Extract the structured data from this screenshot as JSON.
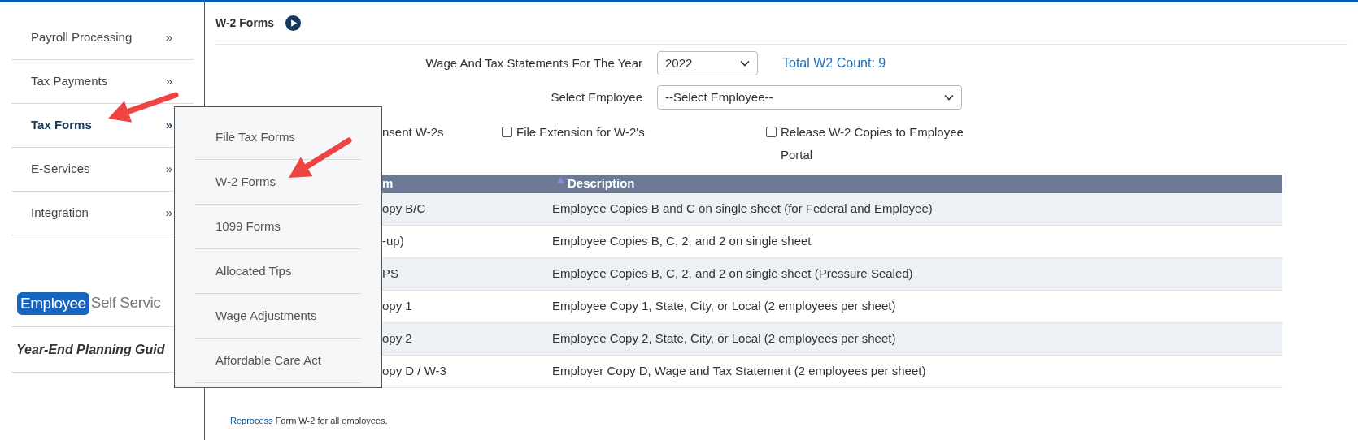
{
  "sidebar": {
    "items": [
      {
        "label": "Payroll Processing",
        "chevron": "»",
        "selected": false
      },
      {
        "label": "Tax Payments",
        "chevron": "»",
        "selected": false
      },
      {
        "label": "Tax Forms",
        "chevron": "»",
        "selected": true
      },
      {
        "label": "E-Services",
        "chevron": "»",
        "selected": false
      },
      {
        "label": "Integration",
        "chevron": "»",
        "selected": false
      }
    ],
    "logo": {
      "badge": "Employee",
      "text": "Self Servic"
    },
    "guide": "Year-End Planning Guid"
  },
  "flyout_menu": {
    "items": [
      {
        "label": "File Tax Forms"
      },
      {
        "label": "W-2 Forms"
      },
      {
        "label": "1099 Forms"
      },
      {
        "label": "Allocated Tips"
      },
      {
        "label": "Wage Adjustments"
      },
      {
        "label": "Affordable Care Act"
      }
    ]
  },
  "page": {
    "title": "W-2 Forms",
    "year_label": "Wage And Tax Statements For The Year",
    "year_value": "2022",
    "total_count": "Total W2 Count: 9",
    "employee_label": "Select Employee",
    "employee_value": "--Select Employee--",
    "partial_option": "nsent W-2s",
    "checkboxes": [
      {
        "label": "File Extension for W-2's",
        "checked": false
      },
      {
        "label": "Release W-2 Copies to Employee Portal",
        "checked": false
      }
    ],
    "table": {
      "columns": [
        {
          "label": "m",
          "sorted": false
        },
        {
          "label": "Description",
          "sorted": true
        }
      ],
      "rows": [
        {
          "cells": [
            "opy B/C",
            "Employee Copies B and C on single sheet (for Federal and Employee)"
          ]
        },
        {
          "cells": [
            "-up)",
            "Employee Copies B, C, 2, and 2 on single sheet"
          ]
        },
        {
          "cells": [
            "PS",
            "Employee Copies B, C, 2, and 2 on single sheet (Pressure Sealed)"
          ]
        },
        {
          "cells": [
            "opy 1",
            "Employee Copy 1, State, City, or Local (2 employees per sheet)"
          ]
        },
        {
          "cells": [
            "opy 2",
            "Employee Copy 2, State, City, or Local (2 employees per sheet)"
          ]
        },
        {
          "cells": [
            "opy D / W-3",
            "Employer Copy D, Wage and Tax Statement (2 employees per sheet)"
          ]
        }
      ]
    },
    "footer": {
      "link": "Reprocess",
      "text": "Form W-2 for all employees."
    }
  }
}
